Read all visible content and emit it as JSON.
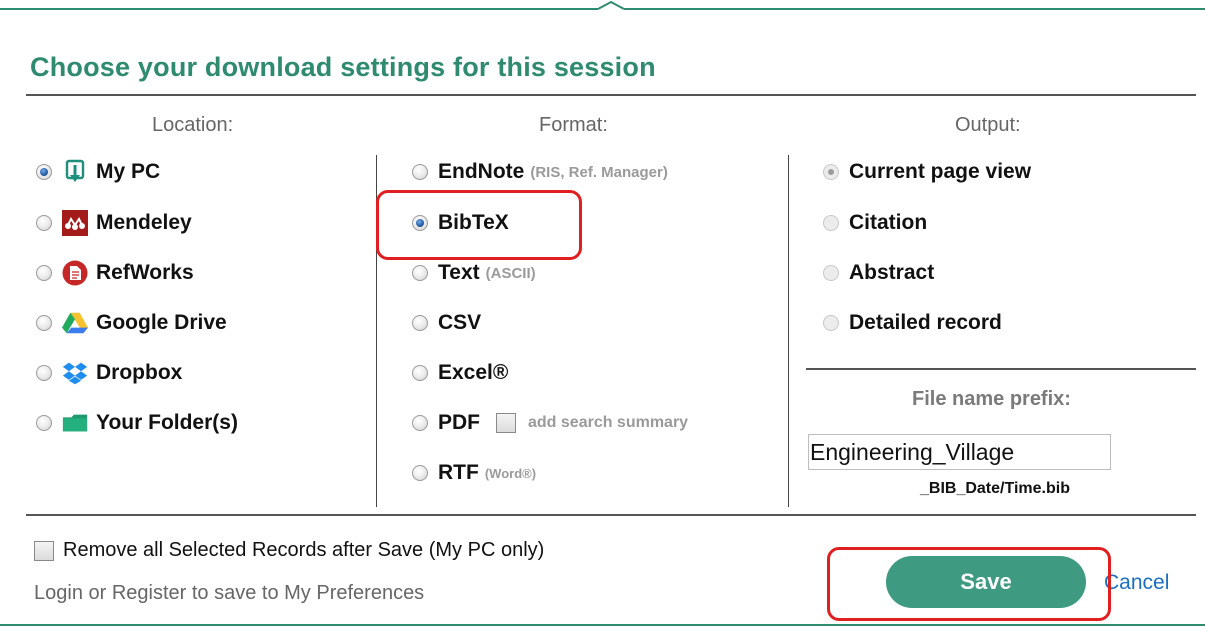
{
  "title": "Choose your download settings for this session",
  "columns": {
    "location": "Location:",
    "format": "Format:",
    "output": "Output:"
  },
  "location_options": [
    {
      "label": "My PC",
      "icon": "download-to-pc-icon",
      "selected": true
    },
    {
      "label": "Mendeley",
      "icon": "mendeley-icon",
      "selected": false
    },
    {
      "label": "RefWorks",
      "icon": "refworks-icon",
      "selected": false
    },
    {
      "label": "Google Drive",
      "icon": "google-drive-icon",
      "selected": false
    },
    {
      "label": "Dropbox",
      "icon": "dropbox-icon",
      "selected": false
    },
    {
      "label": "Your Folder(s)",
      "icon": "folder-icon",
      "selected": false
    }
  ],
  "format_options": [
    {
      "label": "EndNote",
      "sub": "(RIS, Ref. Manager)",
      "selected": false
    },
    {
      "label": "BibTeX",
      "sub": "",
      "selected": true
    },
    {
      "label": "Text",
      "sub": "(ASCII)",
      "selected": false
    },
    {
      "label": "CSV",
      "sub": "",
      "selected": false
    },
    {
      "label": "Excel®",
      "sub": "",
      "selected": false
    },
    {
      "label": "PDF",
      "sub": "add search summary",
      "selected": false
    },
    {
      "label": "RTF",
      "sub": "(Word®)",
      "selected": false
    }
  ],
  "output_options": [
    {
      "label": "Current page view",
      "selected": true,
      "disabled": true
    },
    {
      "label": "Citation",
      "selected": false,
      "disabled": true
    },
    {
      "label": "Abstract",
      "selected": false,
      "disabled": true
    },
    {
      "label": "Detailed record",
      "selected": false,
      "disabled": true
    }
  ],
  "file_prefix": {
    "label": "File name prefix:",
    "value": "Engineering_Village",
    "suffix": "_BIB_Date/Time.bib"
  },
  "remove_records_label": "Remove all Selected Records after Save (My PC only)",
  "login_text": "Login or Register to save to My Preferences",
  "save_label": "Save",
  "cancel_label": "Cancel",
  "colors": {
    "accent": "#2e8b6f",
    "save_button": "#3f9a82",
    "highlight": "#e02020",
    "link": "#1a6fc0"
  }
}
